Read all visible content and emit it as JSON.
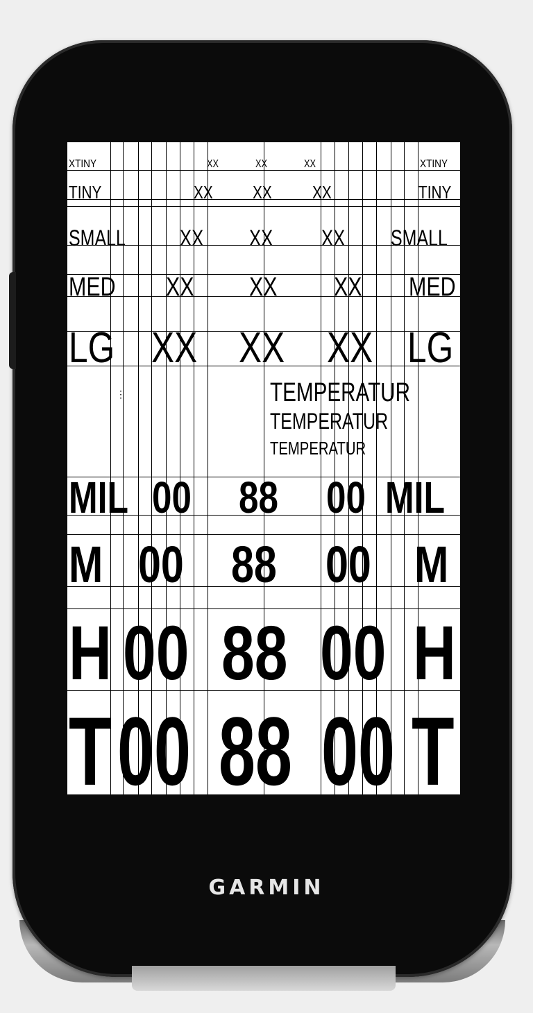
{
  "brand": "GARMIN",
  "rows": {
    "xtiny": {
      "left": "XTINY",
      "c1": "XX",
      "c2": "XX",
      "c3": "XX",
      "right": "XTINY"
    },
    "tiny": {
      "left": "TINY",
      "c1": "XX",
      "c2": "XX",
      "c3": "XX",
      "right": "TINY"
    },
    "small": {
      "left": "SMALL",
      "c1": "XX",
      "c2": "XX",
      "c3": "XX",
      "right": "SMALL"
    },
    "med": {
      "left": "MED",
      "c1": "XX",
      "c2": "XX",
      "c3": "XX",
      "right": "MED"
    },
    "lg": {
      "left": "LG",
      "c1": "XX",
      "c2": "XX",
      "c3": "XX",
      "right": "LG"
    },
    "mil": {
      "left": "MIL",
      "c1": "00",
      "c2": "88",
      "c3": "00",
      "right": "MIL"
    },
    "m": {
      "left": "M",
      "c1": "00",
      "c2": "88",
      "c3": "00",
      "right": "M"
    },
    "h": {
      "left": "H",
      "c1": "00",
      "c2": "88",
      "c3": "00",
      "right": "H"
    },
    "t": {
      "left": "T",
      "c1": "00",
      "c2": "88",
      "c3": "00",
      "right": "T"
    }
  },
  "temperature": [
    "TEMPERATUR",
    "TEMPERATUR",
    "TEMPERATUR"
  ],
  "colors": {
    "screen": "#ffffff",
    "device": "#0b0b0b",
    "ink": "#000000"
  }
}
